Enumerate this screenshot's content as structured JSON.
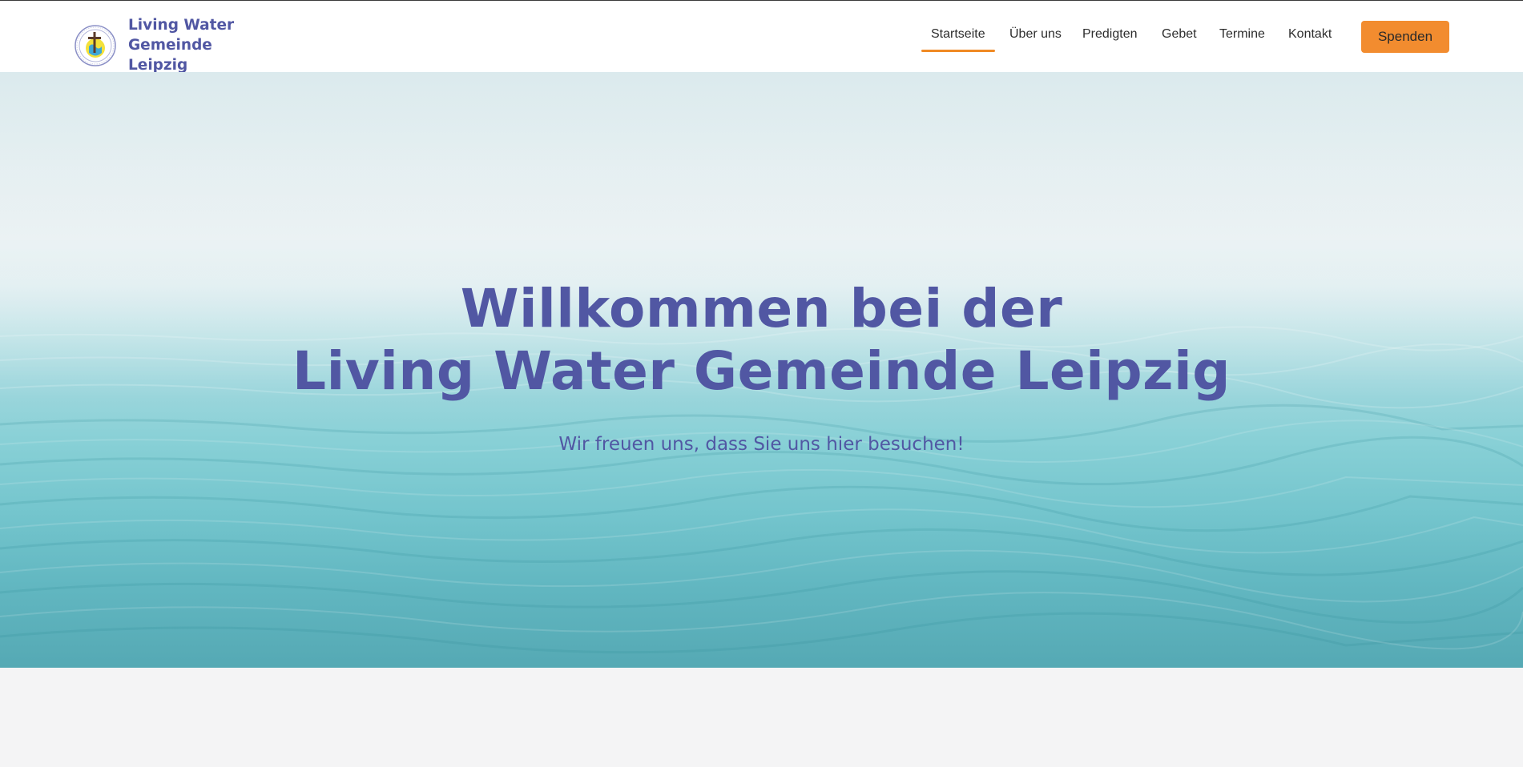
{
  "site": {
    "brand_line1": "Living Water Gemeinde",
    "brand_line2": "Leipzig",
    "logo_icon": "church-seal-logo-icon"
  },
  "nav": {
    "items": [
      {
        "label": "Startseite",
        "active": true
      },
      {
        "label": "Über uns",
        "active": false
      },
      {
        "label": "Predigten",
        "active": false
      },
      {
        "label": "Gebet",
        "active": false
      },
      {
        "label": "Termine",
        "active": false
      },
      {
        "label": "Kontakt",
        "active": false
      }
    ],
    "donate_label": "Spenden"
  },
  "hero": {
    "title_line1": "Willkommen bei der",
    "title_line2": "Living Water Gemeinde Leipzig",
    "subtitle": "Wir freuen uns, dass Sie uns hier besuchen!"
  },
  "colors": {
    "brand": "#5157a3",
    "accent": "#f08a24",
    "header_bg": "#ffffff",
    "page_bg": "#f4f4f5"
  }
}
